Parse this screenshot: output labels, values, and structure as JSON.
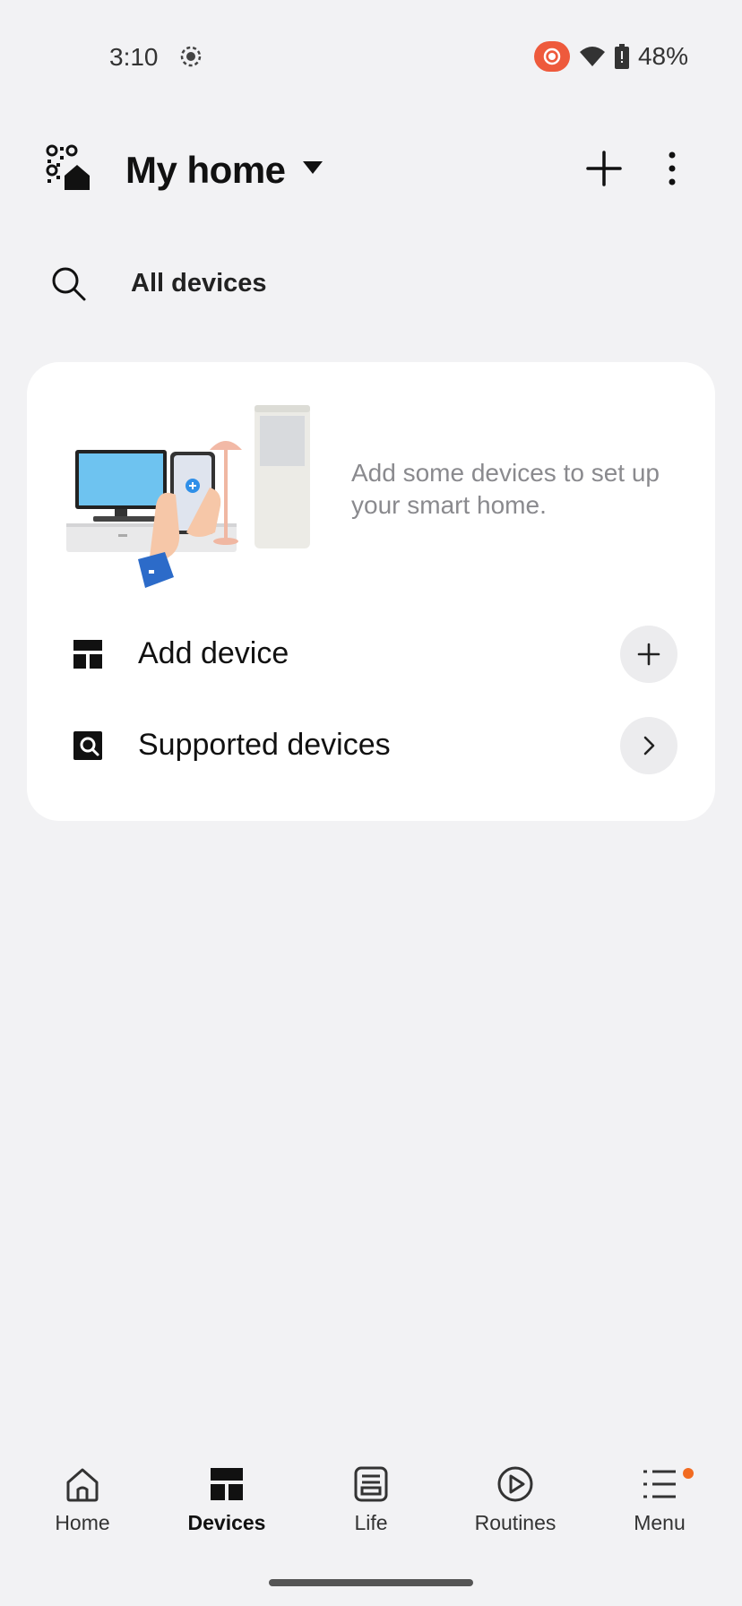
{
  "status_bar": {
    "time": "3:10",
    "battery": "48%",
    "icons": [
      "screen-record-icon",
      "cast-icon",
      "wifi-icon",
      "battery-icon"
    ],
    "cast_color": "#ee5a3c"
  },
  "header": {
    "title": "My home",
    "icons": [
      "qr-home-icon",
      "dropdown-icon",
      "add-icon",
      "more-options-icon"
    ]
  },
  "search": {
    "label": "All devices"
  },
  "card": {
    "message": "Add some devices to set up your smart home.",
    "rows": [
      {
        "label": "Add device",
        "icon": "devices-grid-icon",
        "action_icon": "plus-icon"
      },
      {
        "label": "Supported devices",
        "icon": "search-device-icon",
        "action_icon": "chevron-right-icon"
      }
    ]
  },
  "bottom_nav": {
    "items": [
      {
        "label": "Home",
        "icon": "home-icon",
        "active": false
      },
      {
        "label": "Devices",
        "icon": "devices-icon",
        "active": true
      },
      {
        "label": "Life",
        "icon": "life-icon",
        "active": false
      },
      {
        "label": "Routines",
        "icon": "routines-icon",
        "active": false
      },
      {
        "label": "Menu",
        "icon": "menu-icon",
        "active": false,
        "badge": true
      }
    ],
    "badge_color": "#f26b21"
  }
}
